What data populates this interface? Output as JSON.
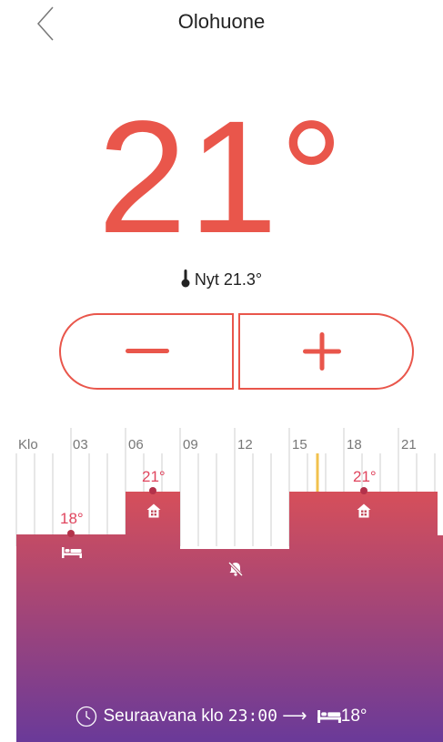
{
  "header": {
    "title": "Olohuone",
    "back_icon": "chevron-left-icon"
  },
  "thermostat": {
    "target_temp": "21°",
    "current_label": "Nyt 21.3°",
    "current_icon": "thermometer-icon",
    "decrease_icon": "minus-icon",
    "increase_icon": "plus-icon",
    "accent_color": "#e9564b"
  },
  "schedule": {
    "klo_label": "Klo",
    "hours": [
      "03",
      "06",
      "09",
      "12",
      "15",
      "18",
      "21"
    ],
    "setpoints": [
      {
        "label": "18°",
        "mode_icon": "bed-icon"
      },
      {
        "label": "21°",
        "mode_icon": "home-icon"
      },
      {
        "mode_icon": "away-bell-off-icon"
      },
      {
        "label": "21°",
        "mode_icon": "home-icon"
      }
    ],
    "gradient_top": "#d64f5a",
    "gradient_bottom": "#6a3a99",
    "now_marker_color": "#f2c14e"
  },
  "next": {
    "label": "Seuraavana klo",
    "time": "23:00",
    "arrow": "⟶",
    "temp": "18°",
    "clock_icon": "clock-icon",
    "bed_icon": "bed-icon"
  }
}
